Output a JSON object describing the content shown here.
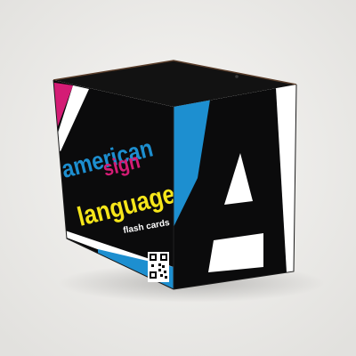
{
  "photo": {
    "colors": {
      "background_light": "#f3f2f0",
      "background_mid": "#e6e5e2",
      "box_black": "#0b0b0c",
      "box_top": "#141414",
      "edge_brown": "#5a3e2b",
      "blue": "#1d8fd0",
      "magenta": "#d41c75",
      "yellow": "#f6e61a",
      "white": "#ffffff"
    },
    "box": {
      "left_face": {
        "title_line_1": "american",
        "title_line_2": "sign",
        "title_line_3": "language",
        "subtitle": "flash cards",
        "has_qr_code": true
      },
      "right_face": {
        "big_letter": "A"
      }
    }
  }
}
